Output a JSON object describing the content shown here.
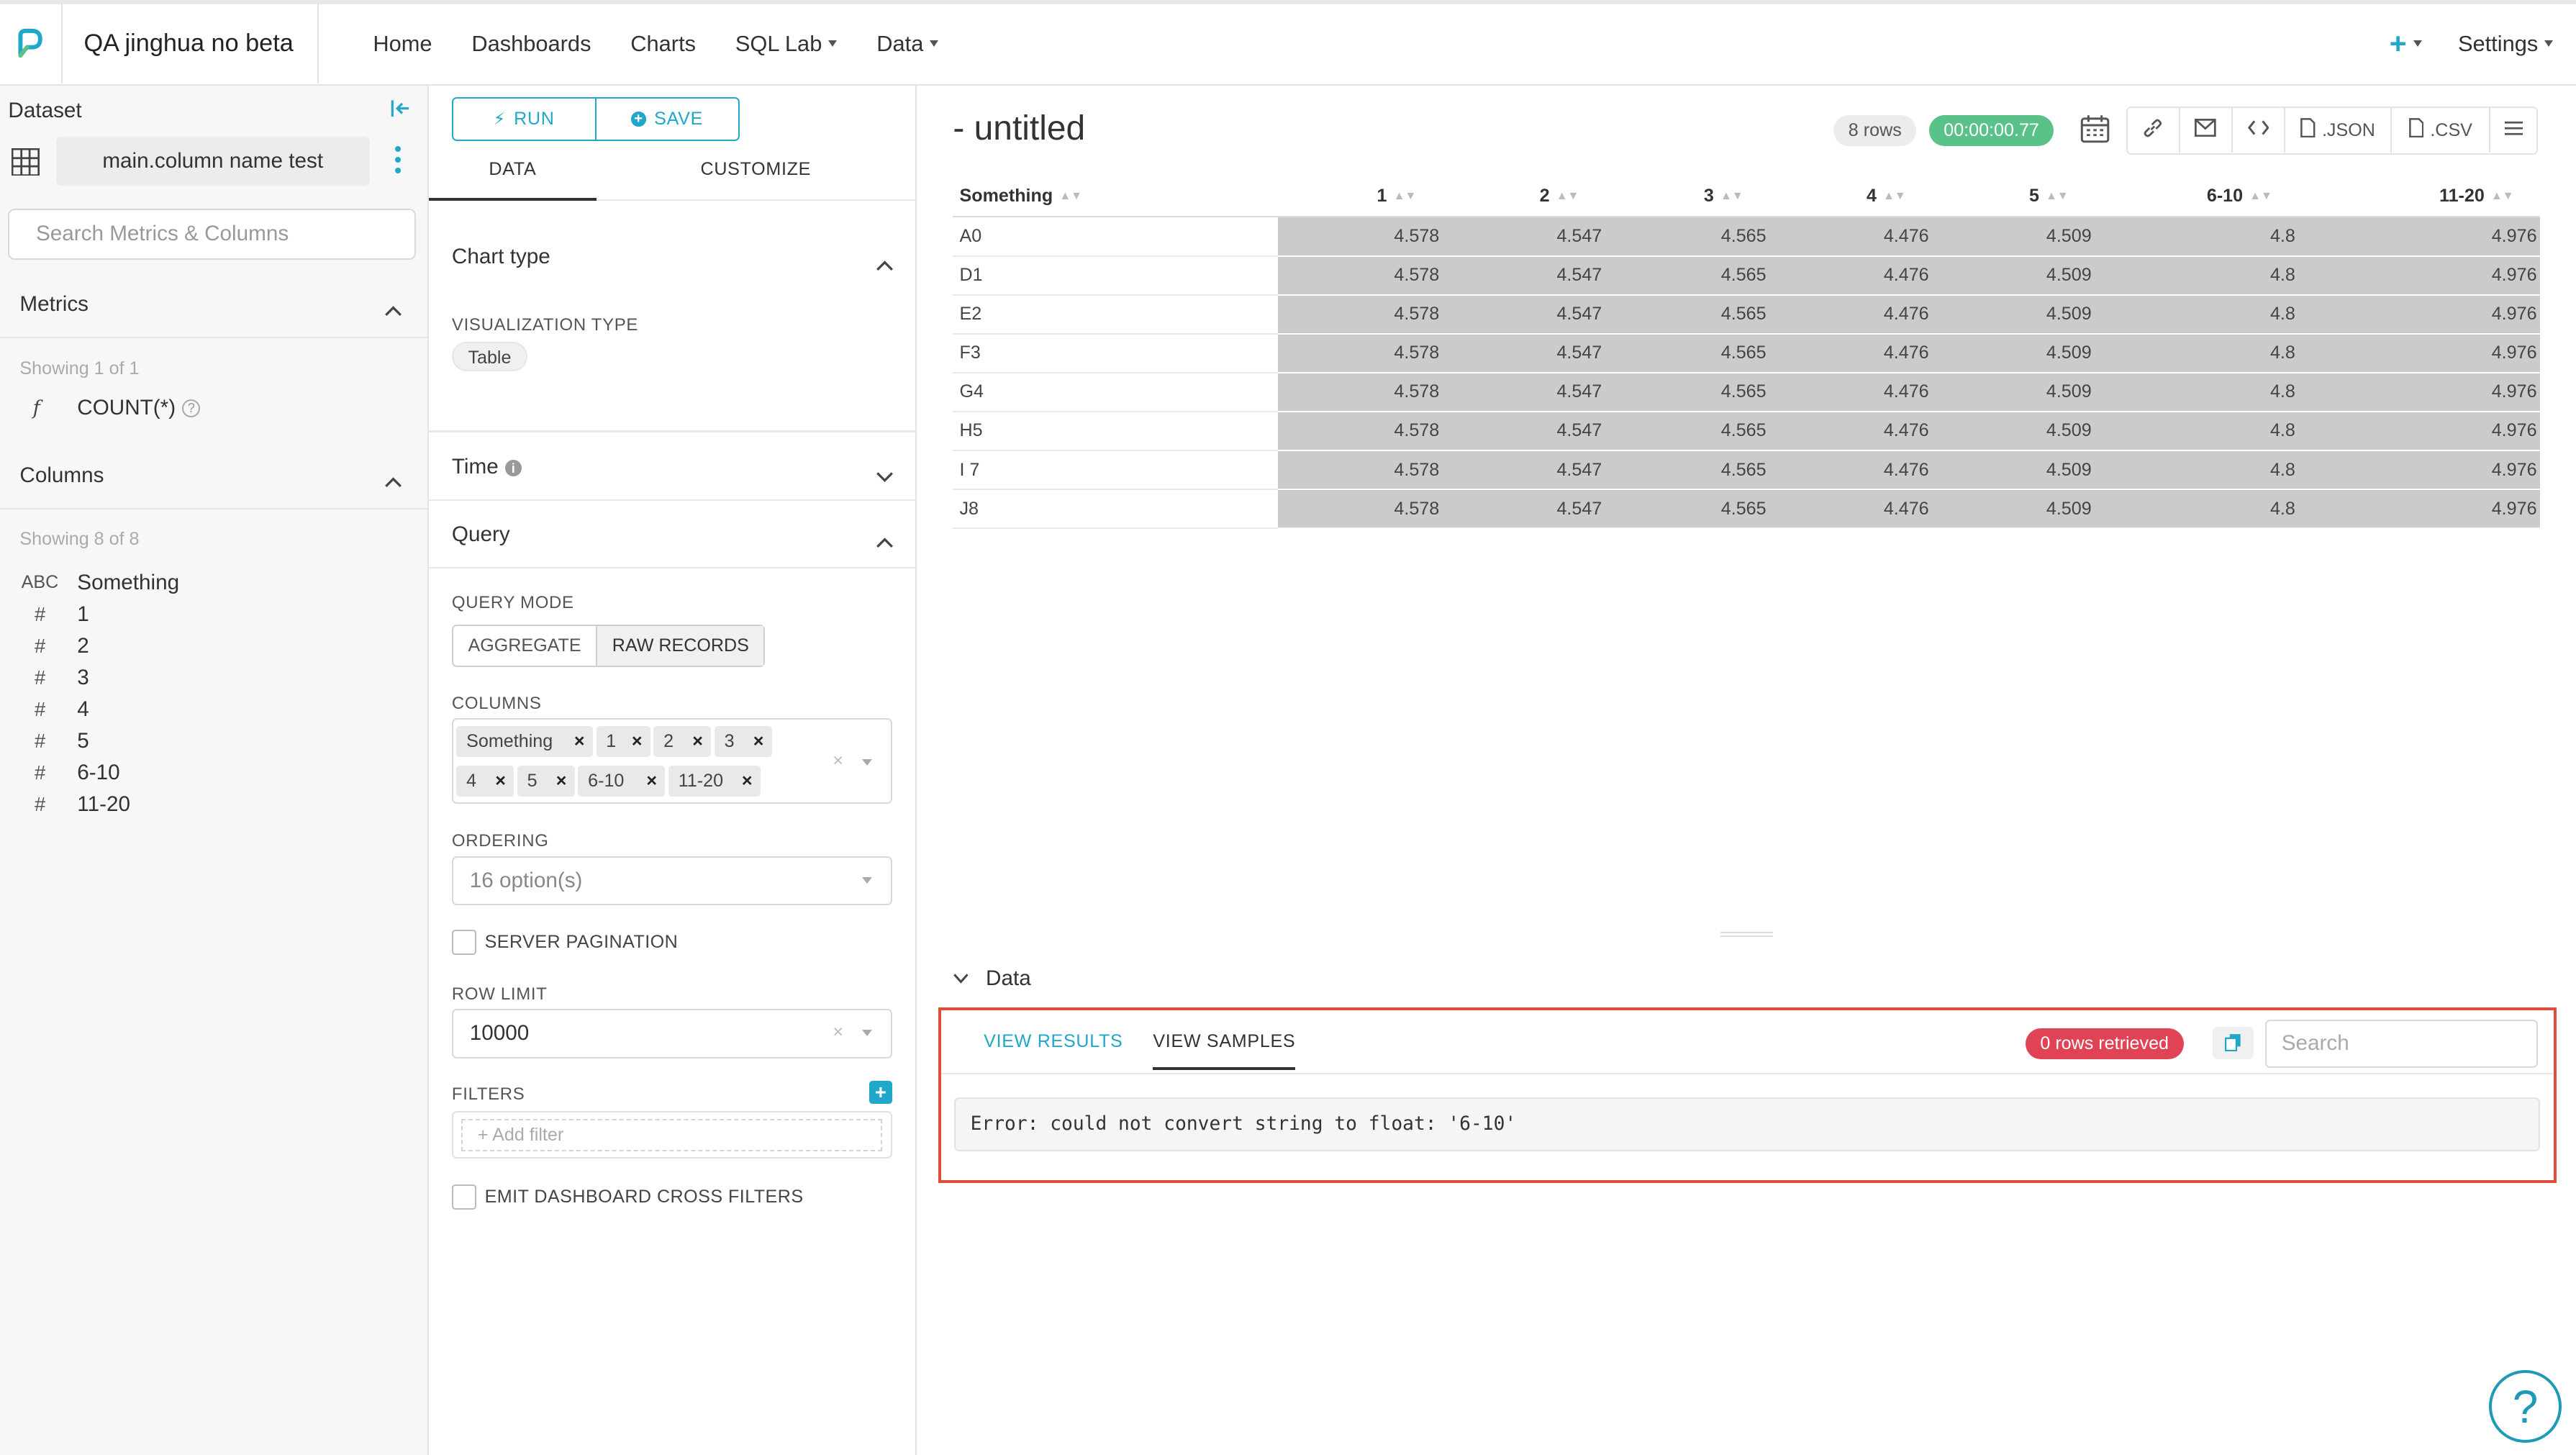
{
  "nav": {
    "brand": "QA jinghua no beta",
    "items": [
      "Home",
      "Dashboards",
      "Charts",
      "SQL Lab",
      "Data"
    ],
    "settings": "Settings",
    "plus": "+"
  },
  "dataset": {
    "title": "Dataset",
    "name": "main.column name test",
    "search_placeholder": "Search Metrics & Columns",
    "metrics_title": "Metrics",
    "metrics_showing": "Showing 1 of 1",
    "metrics": [
      {
        "icon": "f",
        "name": "COUNT(*)"
      }
    ],
    "columns_title": "Columns",
    "columns_showing": "Showing 8 of 8",
    "columns": [
      {
        "type": "ABC",
        "name": "Something"
      },
      {
        "type": "#",
        "name": "1"
      },
      {
        "type": "#",
        "name": "2"
      },
      {
        "type": "#",
        "name": "3"
      },
      {
        "type": "#",
        "name": "4"
      },
      {
        "type": "#",
        "name": "5"
      },
      {
        "type": "#",
        "name": "6-10"
      },
      {
        "type": "#",
        "name": "11-20"
      }
    ]
  },
  "control": {
    "run": "RUN",
    "save": "SAVE",
    "tab_data": "DATA",
    "tab_customize": "CUSTOMIZE",
    "chart_type": "Chart type",
    "viz_type_label": "VISUALIZATION TYPE",
    "viz_type": "Table",
    "time": "Time",
    "query": "Query",
    "query_mode_label": "QUERY MODE",
    "mode_aggregate": "AGGREGATE",
    "mode_raw": "RAW RECORDS",
    "columns_label": "COLUMNS",
    "column_tags": [
      "Something",
      "1",
      "2",
      "3",
      "4",
      "5",
      "6-10",
      "11-20"
    ],
    "ordering_label": "ORDERING",
    "ordering_value": "16 option(s)",
    "server_pagination": "SERVER PAGINATION",
    "row_limit_label": "ROW LIMIT",
    "row_limit": "10000",
    "filters_label": "FILTERS",
    "add_filter": "Add filter",
    "emit_cross_filters": "EMIT DASHBOARD CROSS FILTERS"
  },
  "chart": {
    "title": "- untitled",
    "rows_badge": "8 rows",
    "time_badge": "00:00:00.77",
    "json_btn": ".JSON",
    "csv_btn": ".CSV",
    "headers": [
      "Something",
      "1",
      "2",
      "3",
      "4",
      "5",
      "6-10",
      "11-20"
    ],
    "rows": [
      [
        "A0",
        "4.578",
        "4.547",
        "4.565",
        "4.476",
        "4.509",
        "4.8",
        "4.976"
      ],
      [
        "D1",
        "4.578",
        "4.547",
        "4.565",
        "4.476",
        "4.509",
        "4.8",
        "4.976"
      ],
      [
        "E2",
        "4.578",
        "4.547",
        "4.565",
        "4.476",
        "4.509",
        "4.8",
        "4.976"
      ],
      [
        "F3",
        "4.578",
        "4.547",
        "4.565",
        "4.476",
        "4.509",
        "4.8",
        "4.976"
      ],
      [
        "G4",
        "4.578",
        "4.547",
        "4.565",
        "4.476",
        "4.509",
        "4.8",
        "4.976"
      ],
      [
        "H5",
        "4.578",
        "4.547",
        "4.565",
        "4.476",
        "4.509",
        "4.8",
        "4.976"
      ],
      [
        "I 7",
        "4.578",
        "4.547",
        "4.565",
        "4.476",
        "4.509",
        "4.8",
        "4.976"
      ],
      [
        "J8",
        "4.578",
        "4.547",
        "4.565",
        "4.476",
        "4.509",
        "4.8",
        "4.976"
      ]
    ]
  },
  "data_pane": {
    "title": "Data",
    "tab_results": "VIEW RESULTS",
    "tab_samples": "VIEW SAMPLES",
    "rows_retrieved": "0 rows retrieved",
    "search_placeholder": "Search",
    "error": "Error: could not convert string to float: '6-10'"
  },
  "colors": {
    "accent": "#20a7c9",
    "success": "#5ac189",
    "danger": "#e04355",
    "highlight_border": "#e04e39",
    "cell_bar": "#cbcbcb"
  },
  "icons": {
    "logo": "superset-logo-icon",
    "help": "help-circle-icon"
  }
}
